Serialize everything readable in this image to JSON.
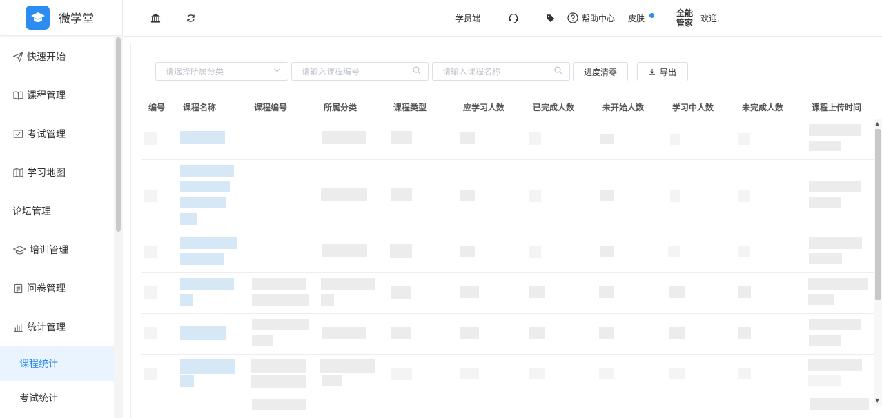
{
  "app": {
    "name": "微学堂"
  },
  "sidebar": {
    "items": [
      {
        "label": "快速开始",
        "icon": "paper-plane-icon"
      },
      {
        "label": "课程管理",
        "icon": "book-icon"
      },
      {
        "label": "考试管理",
        "icon": "exam-icon"
      },
      {
        "label": "学习地图",
        "icon": "map-icon"
      },
      {
        "label": "论坛管理",
        "icon": ""
      },
      {
        "label": "培训管理",
        "icon": "graduation-cap-icon"
      },
      {
        "label": "问卷管理",
        "icon": "survey-icon"
      },
      {
        "label": "统计管理",
        "icon": "bar-chart-icon"
      }
    ],
    "sub_items": [
      {
        "label": "课程统计",
        "active": true
      },
      {
        "label": "考试统计",
        "active": false
      }
    ]
  },
  "header": {
    "student_end": "学员端",
    "help_center": "帮助中心",
    "skin": "皮肤",
    "brand_line1": "全能",
    "brand_line2": "管家",
    "welcome": "欢迎,"
  },
  "filters": {
    "category_placeholder": "请选择所属分类",
    "course_code_placeholder": "请输入课程编号",
    "course_name_placeholder": "请输入课程名称",
    "reset_progress_label": "进度清零",
    "export_label": "导出"
  },
  "table": {
    "columns": [
      "编号",
      "课程名称",
      "课程编号",
      "所属分类",
      "课程类型",
      "应学习人数",
      "已完成人数",
      "未开始人数",
      "学习中人数",
      "未完成人数",
      "课程上传时间"
    ]
  },
  "colors": {
    "accent": "#2d8cf0",
    "active_bg": "#eaf4fe"
  }
}
